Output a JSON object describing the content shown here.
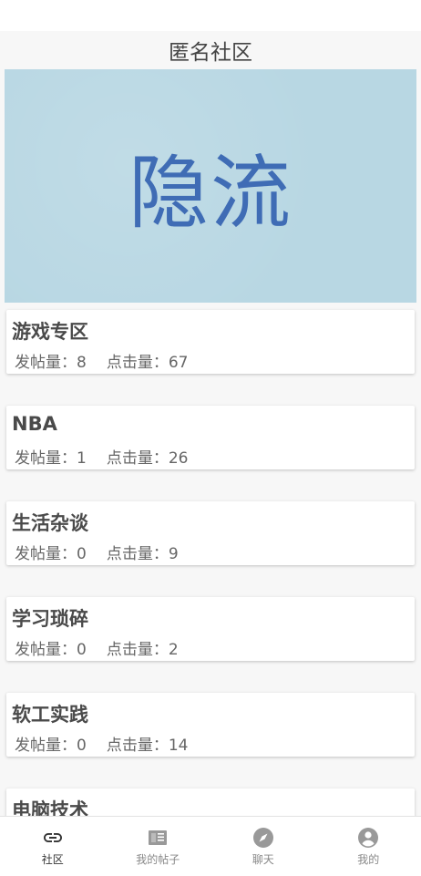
{
  "header": {
    "title": "匿名社区"
  },
  "banner": {
    "text": "隐流"
  },
  "stats_labels": {
    "posts": "发帖量：",
    "clicks": "点击量："
  },
  "boards": [
    {
      "name": "游戏专区",
      "posts": "8",
      "clicks": "67"
    },
    {
      "name": "NBA",
      "posts": "1",
      "clicks": "26"
    },
    {
      "name": "生活杂谈",
      "posts": "0",
      "clicks": "9"
    },
    {
      "name": "学习琐碎",
      "posts": "0",
      "clicks": "2"
    },
    {
      "name": "软工实践",
      "posts": "0",
      "clicks": "14"
    },
    {
      "name": "电脑技术",
      "posts": "",
      "clicks": ""
    }
  ],
  "tabs": [
    {
      "label": "社区",
      "icon": "link-icon",
      "active": true
    },
    {
      "label": "我的帖子",
      "icon": "article-icon",
      "active": false
    },
    {
      "label": "聊天",
      "icon": "compass-icon",
      "active": false
    },
    {
      "label": "我的",
      "icon": "account-circle-icon",
      "active": false
    }
  ],
  "colors": {
    "banner_bg": "#b8d7e3",
    "banner_text": "#3f6cb5"
  }
}
